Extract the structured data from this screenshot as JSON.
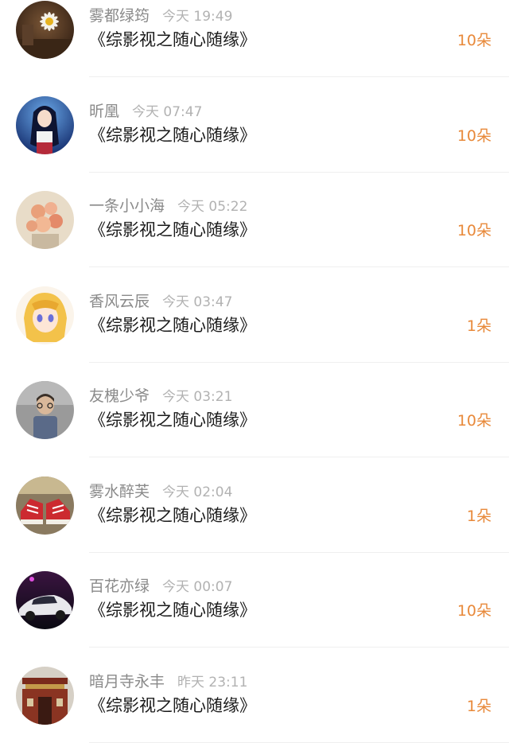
{
  "colors": {
    "accent": "#e8893a",
    "name": "#8a8a8a",
    "time": "#b2b2b2",
    "text": "#1a1a1a"
  },
  "entries": [
    {
      "name": "雾都绿筠",
      "time": "今天 19:49",
      "book": "《综影视之随心随缘》",
      "gift": "10朵",
      "avatar": "daisy-photo"
    },
    {
      "name": "昕凰",
      "time": "今天 07:47",
      "book": "《综影视之随心随缘》",
      "gift": "10朵",
      "avatar": "anime-girl-blue"
    },
    {
      "name": "一条小小海",
      "time": "今天 05:22",
      "book": "《综影视之随心随缘》",
      "gift": "10朵",
      "avatar": "roses-photo"
    },
    {
      "name": "香风云辰",
      "time": "今天 03:47",
      "book": "《综影视之随心随缘》",
      "gift": "1朵",
      "avatar": "anime-blonde"
    },
    {
      "name": "友槐少爷",
      "time": "今天 03:21",
      "book": "《综影视之随心随缘》",
      "gift": "10朵",
      "avatar": "child-photo"
    },
    {
      "name": "雾水醉芙",
      "time": "今天 02:04",
      "book": "《综影视之随心随缘》",
      "gift": "1朵",
      "avatar": "sneakers-photo"
    },
    {
      "name": "百花亦绿",
      "time": "今天 00:07",
      "book": "《综影视之随心随缘》",
      "gift": "10朵",
      "avatar": "sports-car"
    },
    {
      "name": "暗月寺永丰",
      "time": "昨天 23:11",
      "book": "《综影视之随心随缘》",
      "gift": "1朵",
      "avatar": "temple-gate"
    }
  ]
}
